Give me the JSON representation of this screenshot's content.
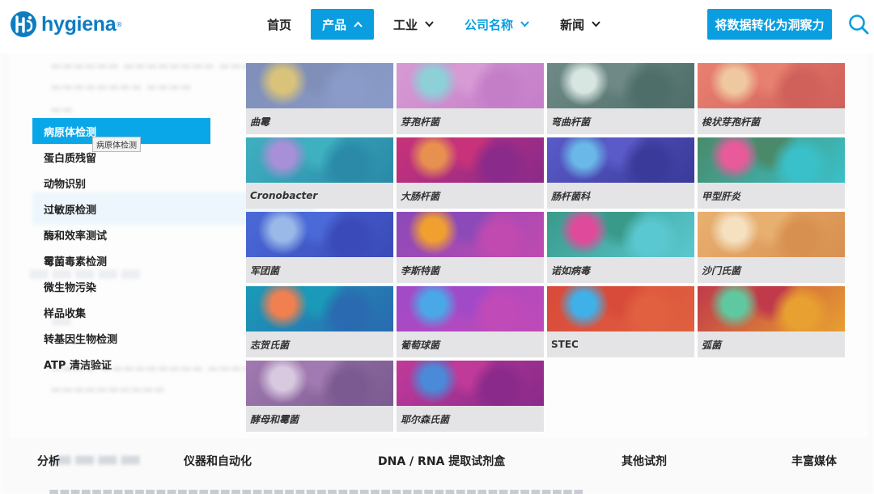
{
  "brand": {
    "name": "hygiena",
    "mark": "®",
    "color": "#0d7cc1"
  },
  "nav": {
    "items": [
      {
        "label": "首页",
        "dropdown": false,
        "active": false
      },
      {
        "label": "产品",
        "dropdown": true,
        "active": true
      },
      {
        "label": "工业",
        "dropdown": true,
        "active": false
      },
      {
        "label": "公司名称",
        "dropdown": true,
        "active": false
      },
      {
        "label": "新闻",
        "dropdown": true,
        "active": false
      }
    ],
    "cta_label": "将数据转化为洞察力",
    "search_icon": "search-icon",
    "accent": "#0a9ee0"
  },
  "sidebar": {
    "items": [
      {
        "label": "病原体检测",
        "active": true
      },
      {
        "label": "蛋白质残留",
        "active": false
      },
      {
        "label": "动物识别",
        "active": false
      },
      {
        "label": "过敏原检测",
        "active": false
      },
      {
        "label": "酶和效率测试",
        "active": false
      },
      {
        "label": "霉菌毒素检测",
        "active": false
      },
      {
        "label": "微生物污染",
        "active": false
      },
      {
        "label": "样品收集",
        "active": false
      },
      {
        "label": "转基因生物检测",
        "active": false
      },
      {
        "label": "ATP 清洁验证",
        "active": false
      }
    ],
    "tooltip": "病原体检测"
  },
  "tiles": [
    {
      "label": "曲霉",
      "colors": [
        "#7f8fb8",
        "#d9c27a",
        "#8a9bc9"
      ]
    },
    {
      "label": "芽孢杆菌",
      "colors": [
        "#d79ad4",
        "#8ed0d8",
        "#c47ec8"
      ]
    },
    {
      "label": "弯曲杆菌",
      "colors": [
        "#6f8a86",
        "#d8e6e2",
        "#4e6e6a"
      ]
    },
    {
      "label": "梭状芽孢杆菌",
      "colors": [
        "#e88070",
        "#f0c8a0",
        "#d0605a"
      ]
    },
    {
      "label": "Cronobacter",
      "colors": [
        "#3fb0c0",
        "#a890d8",
        "#2a8aa8"
      ]
    },
    {
      "label": "大肠杆菌",
      "colors": [
        "#c8327a",
        "#e89050",
        "#8a2a8a"
      ]
    },
    {
      "label": "肠杆菌科",
      "colors": [
        "#5a5ac8",
        "#6ab8e8",
        "#3a3a9a"
      ]
    },
    {
      "label": "甲型肝炎",
      "colors": [
        "#4a8a6a",
        "#e85a9a",
        "#3ac0c8"
      ]
    },
    {
      "label": "军团菌",
      "colors": [
        "#4a6ad8",
        "#9ab8e8",
        "#3a4ab8"
      ]
    },
    {
      "label": "李斯特菌",
      "colors": [
        "#8a4ab8",
        "#f0a030",
        "#c04ab0"
      ]
    },
    {
      "label": "诺如病毒",
      "colors": [
        "#3a9a8a",
        "#e04a9a",
        "#5ac8d0"
      ]
    },
    {
      "label": "沙门氏菌",
      "colors": [
        "#e8b070",
        "#f5e0c0",
        "#d89050"
      ]
    },
    {
      "label": "志贺氏菌",
      "colors": [
        "#1a9ab8",
        "#f08050",
        "#2a6ab0"
      ]
    },
    {
      "label": "葡萄球菌",
      "colors": [
        "#a04ac8",
        "#4aa8e8",
        "#c04ab8"
      ]
    },
    {
      "label": "STEC",
      "colors": [
        "#d84a3a",
        "#40b0e8",
        "#e06040"
      ]
    },
    {
      "label": "弧菌",
      "colors": [
        "#c03a4a",
        "#60c8a0",
        "#e8a030"
      ]
    },
    {
      "label": "酵母和霉菌",
      "colors": [
        "#a07ab0",
        "#d8c8e0",
        "#7a5a90"
      ]
    },
    {
      "label": "耶尔森氏菌",
      "colors": [
        "#c03a9a",
        "#4a8ad8",
        "#8a2a8a"
      ]
    }
  ],
  "bottom_row": [
    "分析",
    "仪器和自动化",
    "DNA / RNA 提取试剂盒",
    "其他试剂",
    "丰富媒体"
  ]
}
